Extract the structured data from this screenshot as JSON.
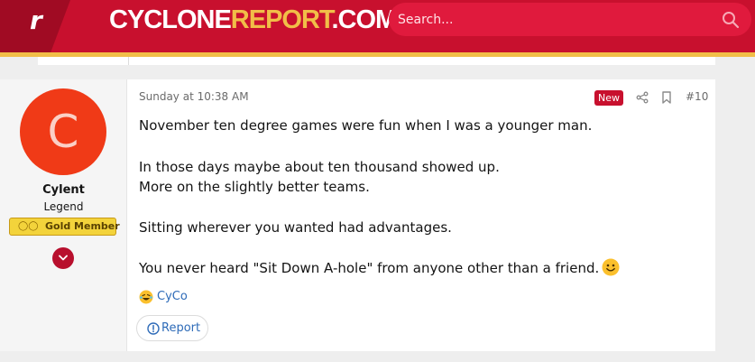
{
  "header": {
    "logo_letter": "r",
    "site_title_part1": "CYCLONE",
    "site_title_part2": "REPORT",
    "site_title_part3": ".COM",
    "search_placeholder": "Search..."
  },
  "colors": {
    "brand_red": "#c8102e",
    "brand_gold": "#f1be48",
    "avatar_bg": "#f03a17",
    "link_blue": "#2e6bb8"
  },
  "post": {
    "author": {
      "avatar_letter": "C",
      "username": "Cylent",
      "title": "Legend",
      "badge_label": "Gold Member",
      "badge_icon": "shield-icon"
    },
    "timestamp": "Sunday at 10:38 AM",
    "new_label": "New",
    "post_number": "#10",
    "message_lines": [
      "November ten degree games were fun when I was a younger man.",
      "In those days maybe about ten thousand showed up.",
      "More on the slightly better teams.",
      "Sitting wherever you wanted had advantages.",
      "You never heard \"Sit Down A-hole\" from anyone other than a friend."
    ],
    "reaction": {
      "emoji": "laughing-emoji",
      "user": "CyCo"
    },
    "report_label": "Report"
  }
}
